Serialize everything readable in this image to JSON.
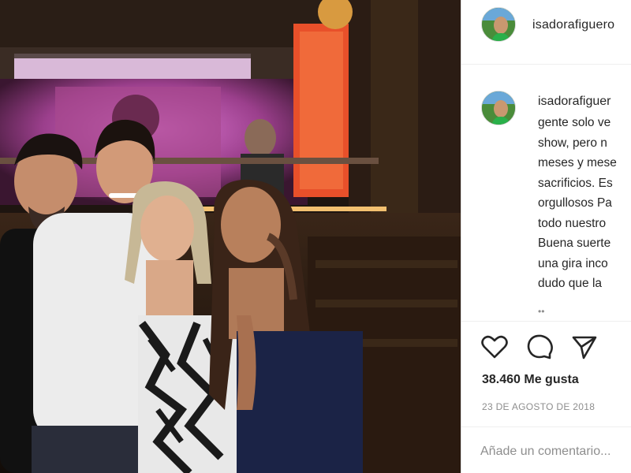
{
  "post": {
    "username": "isadorafiguero",
    "caption_username": "isadorafiguer",
    "caption_lines": "gente solo ve\nshow, pero n\nmeses y mese\nsacrificios. Es\norgullosos Pa\ntodo nuestro\nBuena suerte\nuna gira inco\ndudo que la",
    "more_indicator": "••",
    "likes": "38.460 Me gusta",
    "date": "23 DE AGOSTO DE 2018",
    "comment_placeholder": "Añade un comentario..."
  },
  "icons": {
    "like": "heart-icon",
    "comment": "comment-bubble-icon",
    "share": "paper-plane-icon"
  },
  "colors": {
    "text": "#262626",
    "muted": "#8e8e8e",
    "border": "#dbdbdb"
  }
}
